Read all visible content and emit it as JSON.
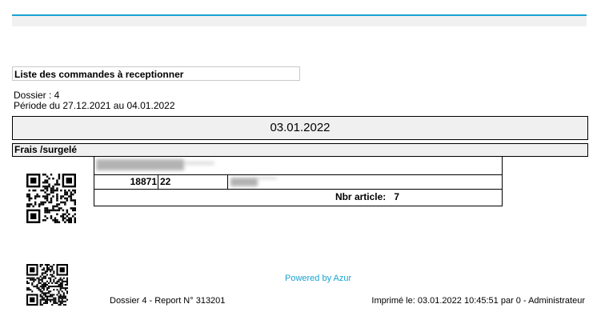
{
  "report": {
    "title": "Liste des commandes à receptionner",
    "dossier": "Dossier : 4",
    "periode": "Période du 27.12.2021  au 04.01.2022",
    "date": "03.01.2022",
    "category": "Frais /surgelé"
  },
  "order": {
    "number": "18871",
    "code": "22",
    "summary_label": "Nbr article:",
    "summary_value": "7"
  },
  "footer": {
    "powered_by": "Powered by Azur",
    "left": "Dossier 4 - Report N° 313201",
    "right": "Imprimé le: 03.01.2022 10:45:51 par 0 - Administrateur"
  },
  "colors": {
    "accent": "#1aa3d1"
  },
  "icons": [
    "qr-code-icon"
  ]
}
